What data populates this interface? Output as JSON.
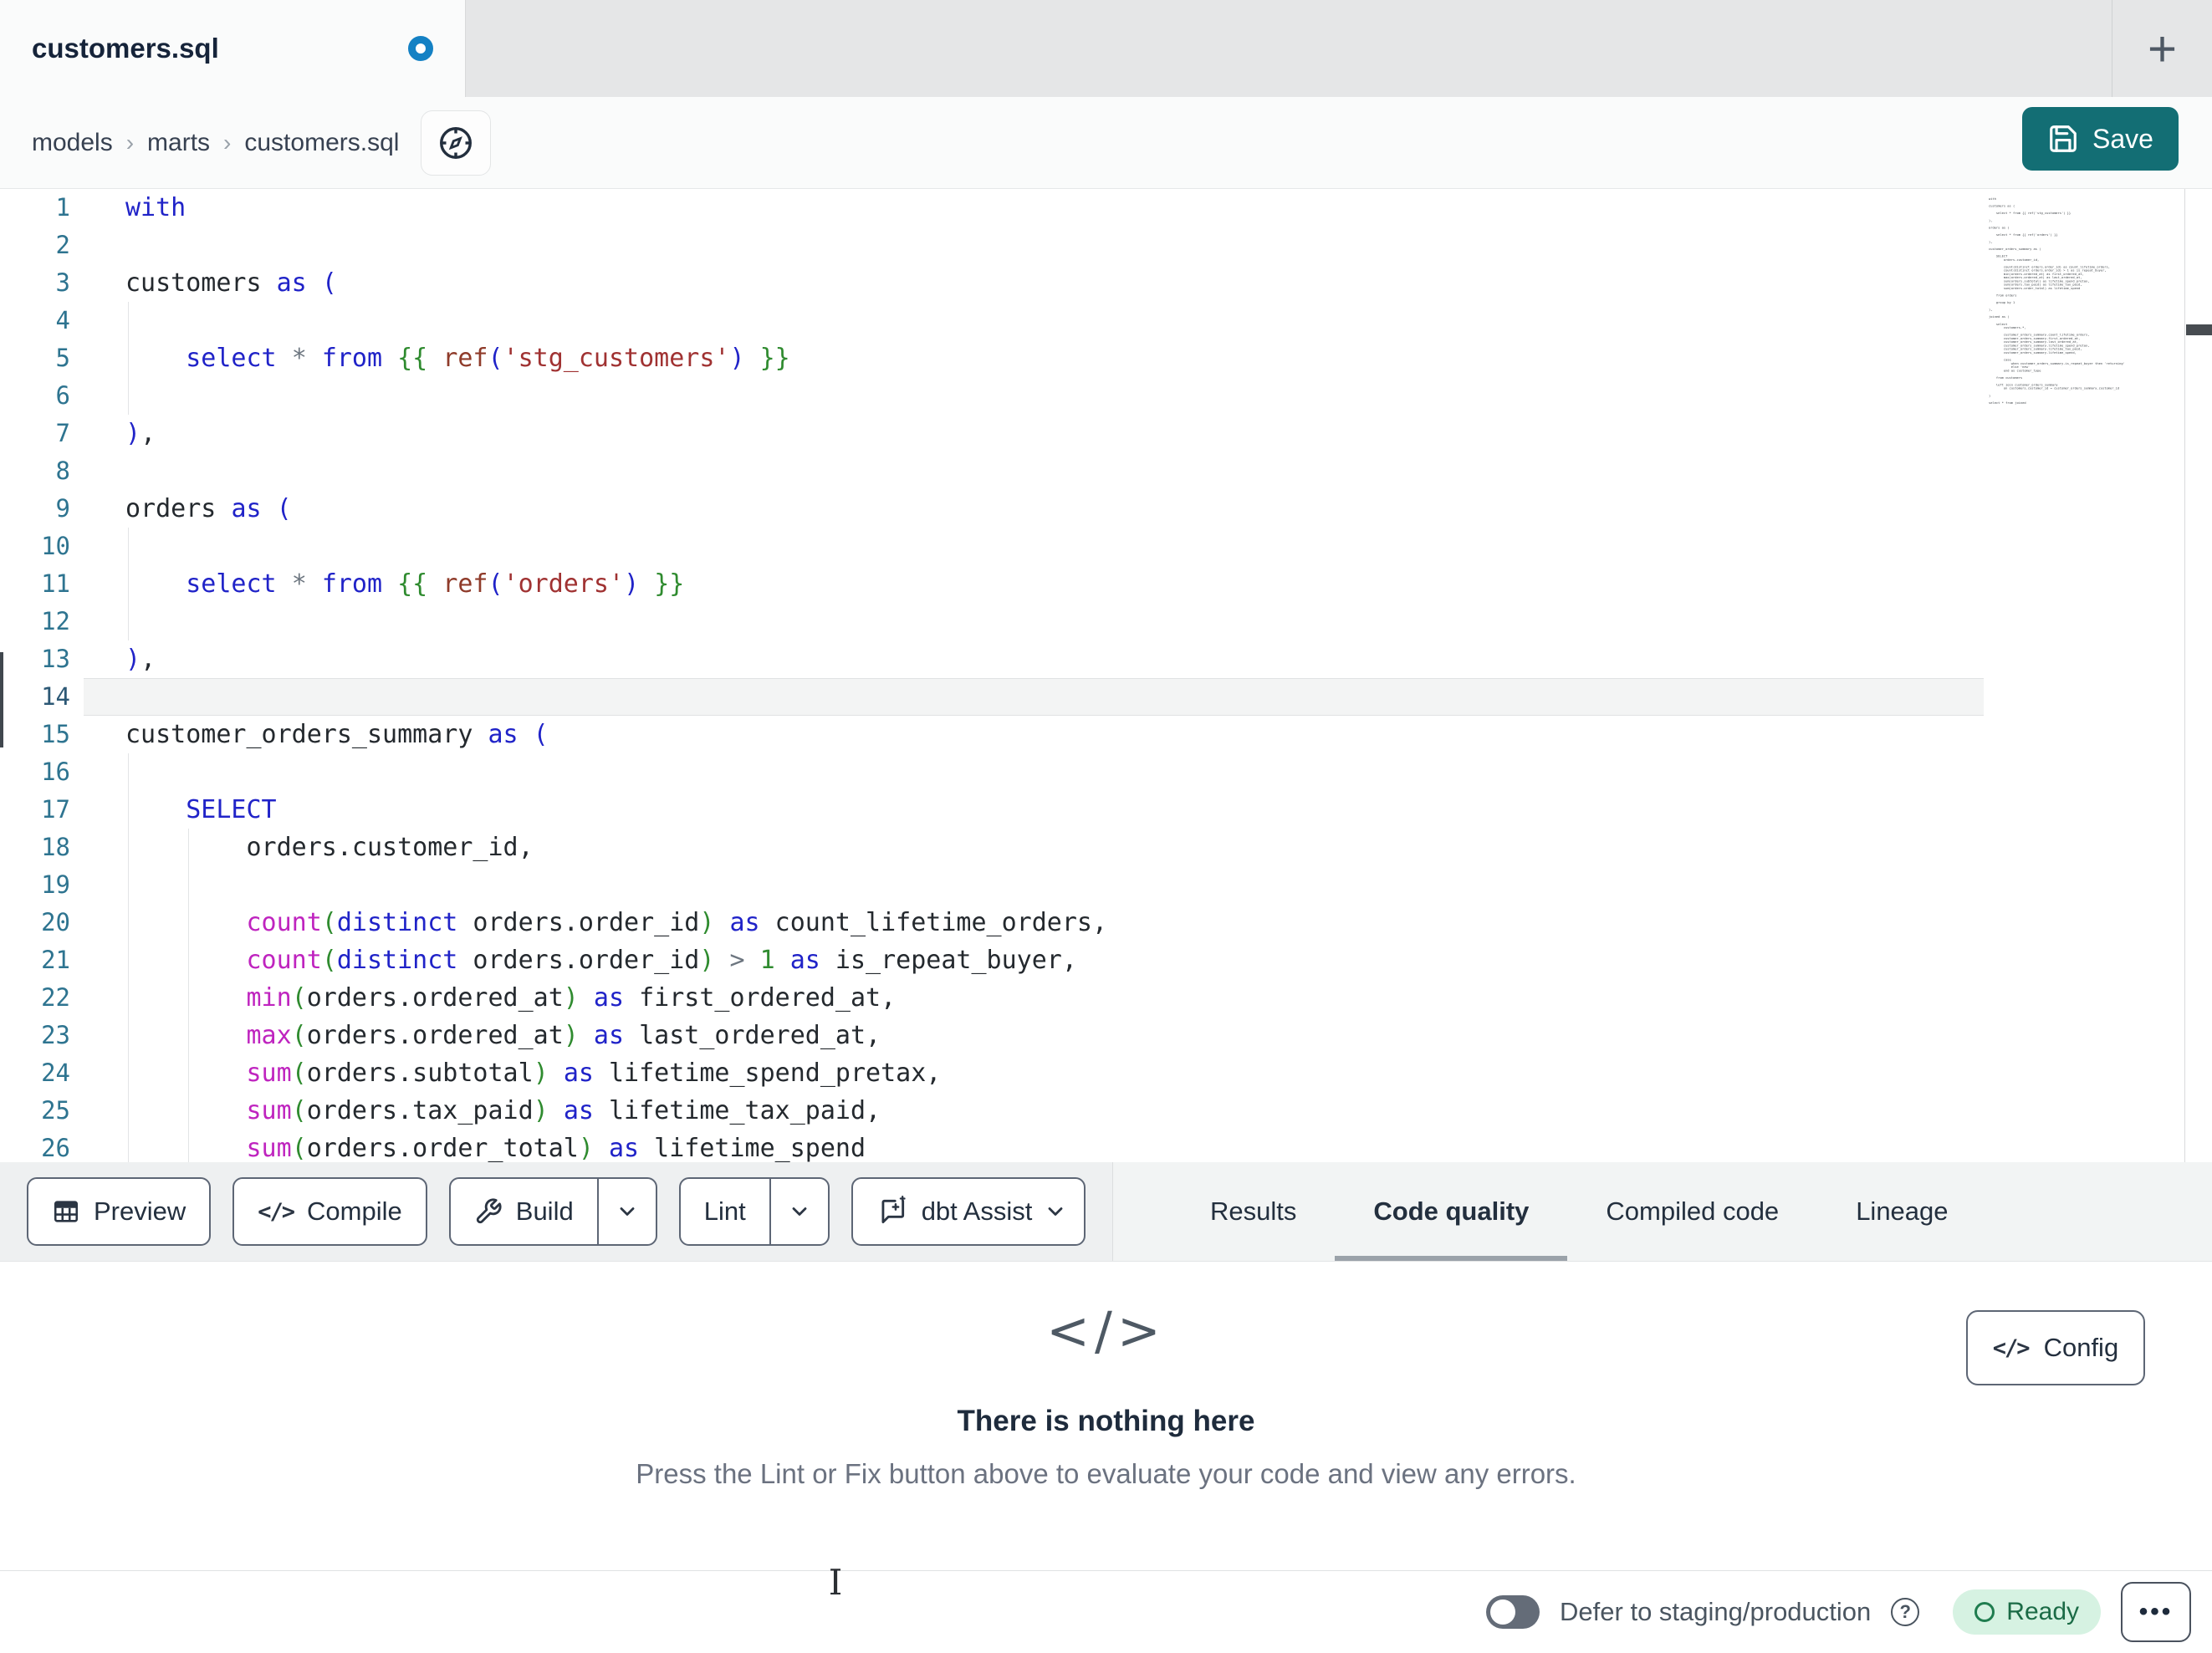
{
  "tab_bar": {
    "active_tab_title": "customers.sql",
    "new_tab_glyph": "+"
  },
  "breadcrumb": {
    "items": [
      "models",
      "marts",
      "customers.sql"
    ],
    "separator": "›"
  },
  "actions": {
    "save_label": "Save"
  },
  "editor": {
    "lines": [
      {
        "n": 1,
        "g": 0,
        "t": [
          [
            "k",
            "with"
          ]
        ]
      },
      {
        "n": 2,
        "g": 0,
        "t": []
      },
      {
        "n": 3,
        "g": 0,
        "t": [
          [
            "t",
            "customers "
          ],
          [
            "k",
            "as"
          ],
          [
            "t",
            " "
          ],
          [
            "k",
            "("
          ]
        ]
      },
      {
        "n": 4,
        "g": 1,
        "t": []
      },
      {
        "n": 5,
        "g": 1,
        "t": [
          [
            "t",
            "    "
          ],
          [
            "k",
            "select"
          ],
          [
            "t",
            " "
          ],
          [
            "o",
            "*"
          ],
          [
            "t",
            " "
          ],
          [
            "k",
            "from"
          ],
          [
            "t",
            " "
          ],
          [
            "g",
            "{{"
          ],
          [
            "t",
            " "
          ],
          [
            "r",
            "ref"
          ],
          [
            "k",
            "("
          ],
          [
            "s",
            "'stg_customers'"
          ],
          [
            "k",
            ")"
          ],
          [
            "t",
            " "
          ],
          [
            "g",
            "}}"
          ]
        ]
      },
      {
        "n": 6,
        "g": 1,
        "t": []
      },
      {
        "n": 7,
        "g": 0,
        "t": [
          [
            "k",
            ")"
          ],
          [
            "t",
            ","
          ]
        ]
      },
      {
        "n": 8,
        "g": 0,
        "t": []
      },
      {
        "n": 9,
        "g": 0,
        "t": [
          [
            "t",
            "orders "
          ],
          [
            "k",
            "as"
          ],
          [
            "t",
            " "
          ],
          [
            "k",
            "("
          ]
        ]
      },
      {
        "n": 10,
        "g": 1,
        "t": []
      },
      {
        "n": 11,
        "g": 1,
        "t": [
          [
            "t",
            "    "
          ],
          [
            "k",
            "select"
          ],
          [
            "t",
            " "
          ],
          [
            "o",
            "*"
          ],
          [
            "t",
            " "
          ],
          [
            "k",
            "from"
          ],
          [
            "t",
            " "
          ],
          [
            "g",
            "{{"
          ],
          [
            "t",
            " "
          ],
          [
            "r",
            "ref"
          ],
          [
            "k",
            "("
          ],
          [
            "s",
            "'orders'"
          ],
          [
            "k",
            ")"
          ],
          [
            "t",
            " "
          ],
          [
            "g",
            "}}"
          ]
        ]
      },
      {
        "n": 12,
        "g": 1,
        "t": []
      },
      {
        "n": 13,
        "g": 0,
        "t": [
          [
            "k",
            ")"
          ],
          [
            "t",
            ","
          ]
        ]
      },
      {
        "n": 14,
        "g": 0,
        "h": true,
        "t": []
      },
      {
        "n": 15,
        "g": 0,
        "t": [
          [
            "t",
            "customer_orders_summary "
          ],
          [
            "k",
            "as"
          ],
          [
            "t",
            " "
          ],
          [
            "k",
            "("
          ]
        ]
      },
      {
        "n": 16,
        "g": 1,
        "t": []
      },
      {
        "n": 17,
        "g": 1,
        "t": [
          [
            "t",
            "    "
          ],
          [
            "k",
            "SELECT"
          ]
        ]
      },
      {
        "n": 18,
        "g": 2,
        "t": [
          [
            "t",
            "        orders.customer_id,"
          ]
        ]
      },
      {
        "n": 19,
        "g": 2,
        "t": []
      },
      {
        "n": 20,
        "g": 2,
        "t": [
          [
            "t",
            "        "
          ],
          [
            "f",
            "count"
          ],
          [
            "g",
            "("
          ],
          [
            "k",
            "distinct"
          ],
          [
            "t",
            " orders.order_id"
          ],
          [
            "g",
            ")"
          ],
          [
            "t",
            " "
          ],
          [
            "k",
            "as"
          ],
          [
            "t",
            " count_lifetime_orders,"
          ]
        ]
      },
      {
        "n": 21,
        "g": 2,
        "t": [
          [
            "t",
            "        "
          ],
          [
            "f",
            "count"
          ],
          [
            "g",
            "("
          ],
          [
            "k",
            "distinct"
          ],
          [
            "t",
            " orders.order_id"
          ],
          [
            "g",
            ")"
          ],
          [
            "t",
            " "
          ],
          [
            "o",
            ">"
          ],
          [
            "t",
            " "
          ],
          [
            "g",
            "1"
          ],
          [
            "t",
            " "
          ],
          [
            "k",
            "as"
          ],
          [
            "t",
            " is_repeat_buyer,"
          ]
        ]
      },
      {
        "n": 22,
        "g": 2,
        "t": [
          [
            "t",
            "        "
          ],
          [
            "f",
            "min"
          ],
          [
            "g",
            "("
          ],
          [
            "t",
            "orders.ordered_at"
          ],
          [
            "g",
            ")"
          ],
          [
            "t",
            " "
          ],
          [
            "k",
            "as"
          ],
          [
            "t",
            " first_ordered_at,"
          ]
        ]
      },
      {
        "n": 23,
        "g": 2,
        "t": [
          [
            "t",
            "        "
          ],
          [
            "f",
            "max"
          ],
          [
            "g",
            "("
          ],
          [
            "t",
            "orders.ordered_at"
          ],
          [
            "g",
            ")"
          ],
          [
            "t",
            " "
          ],
          [
            "k",
            "as"
          ],
          [
            "t",
            " last_ordered_at,"
          ]
        ]
      },
      {
        "n": 24,
        "g": 2,
        "t": [
          [
            "t",
            "        "
          ],
          [
            "f",
            "sum"
          ],
          [
            "g",
            "("
          ],
          [
            "t",
            "orders.subtotal"
          ],
          [
            "g",
            ")"
          ],
          [
            "t",
            " "
          ],
          [
            "k",
            "as"
          ],
          [
            "t",
            " lifetime_spend_pretax,"
          ]
        ]
      },
      {
        "n": 25,
        "g": 2,
        "t": [
          [
            "t",
            "        "
          ],
          [
            "f",
            "sum"
          ],
          [
            "g",
            "("
          ],
          [
            "t",
            "orders.tax_paid"
          ],
          [
            "g",
            ")"
          ],
          [
            "t",
            " "
          ],
          [
            "k",
            "as"
          ],
          [
            "t",
            " lifetime_tax_paid,"
          ]
        ]
      },
      {
        "n": 26,
        "g": 2,
        "t": [
          [
            "t",
            "        "
          ],
          [
            "f",
            "sum"
          ],
          [
            "g",
            "("
          ],
          [
            "t",
            "orders.order_total"
          ],
          [
            "g",
            ")"
          ],
          [
            "t",
            " "
          ],
          [
            "k",
            "as"
          ],
          [
            "t",
            " lifetime_spend"
          ]
        ]
      }
    ],
    "minimap_lines": [
      "with",
      "",
      "customers as (",
      "",
      "    select * from {{ ref('stg_customers') }}",
      "",
      "),",
      "",
      "orders as (",
      "",
      "    select * from {{ ref('orders') }}",
      "",
      "),",
      "",
      "customer_orders_summary as (",
      "",
      "    SELECT",
      "        orders.customer_id,",
      "",
      "        count(distinct orders.order_id) as count_lifetime_orders,",
      "        count(distinct orders.order_id) > 1 as is_repeat_buyer,",
      "        min(orders.ordered_at) as first_ordered_at,",
      "        max(orders.ordered_at) as last_ordered_at,",
      "        sum(orders.subtotal) as lifetime_spend_pretax,",
      "        sum(orders.tax_paid) as lifetime_tax_paid,",
      "        sum(orders.order_total) as lifetime_spend",
      "",
      "    from orders",
      "",
      "    group by 1",
      "",
      "),",
      "",
      "joined as (",
      "",
      "    select",
      "        customers.*,",
      "",
      "        customer_orders_summary.count_lifetime_orders,",
      "        customer_orders_summary.first_ordered_at,",
      "        customer_orders_summary.last_ordered_at,",
      "        customer_orders_summary.lifetime_spend_pretax,",
      "        customer_orders_summary.lifetime_tax_paid,",
      "        customer_orders_summary.lifetime_spend,",
      "",
      "        case",
      "            when customer_orders_summary.is_repeat_buyer then 'returning'",
      "            else 'new'",
      "        end as customer_type",
      "",
      "    from customers",
      "",
      "    left join customer_orders_summary",
      "        on customers.customer_id = customer_orders_summary.customer_id",
      "",
      ")",
      "",
      "select * from joined"
    ]
  },
  "toolbar": {
    "preview_label": "Preview",
    "compile_label": "Compile",
    "build_label": "Build",
    "lint_label": "Lint",
    "assist_label": "dbt Assist"
  },
  "tabs": [
    {
      "label": "Results",
      "active": false
    },
    {
      "label": "Code quality",
      "active": true
    },
    {
      "label": "Compiled code",
      "active": false
    },
    {
      "label": "Lineage",
      "active": false
    }
  ],
  "empty_state": {
    "icon_glyph": "</>",
    "title": "There is nothing here",
    "subtitle": "Press the Lint or Fix button above to evaluate your code and view any errors."
  },
  "config": {
    "label": "Config",
    "icon_glyph": "</>"
  },
  "status_bar": {
    "defer_label": "Defer to staging/production",
    "help_glyph": "?",
    "ready_label": "Ready",
    "overflow_glyph": "•••"
  },
  "colors": {
    "accent_teal": "#136e74",
    "keyword_blue": "#2023c8",
    "function_magenta": "#bf24bf",
    "jinja_green": "#2f8b2f",
    "ref_brown": "#8f3b2a",
    "string_red": "#a03232",
    "ready_green": "#1b6b46",
    "tab_dot_blue": "#1481c4",
    "line_number_teal": "#2e7490"
  }
}
